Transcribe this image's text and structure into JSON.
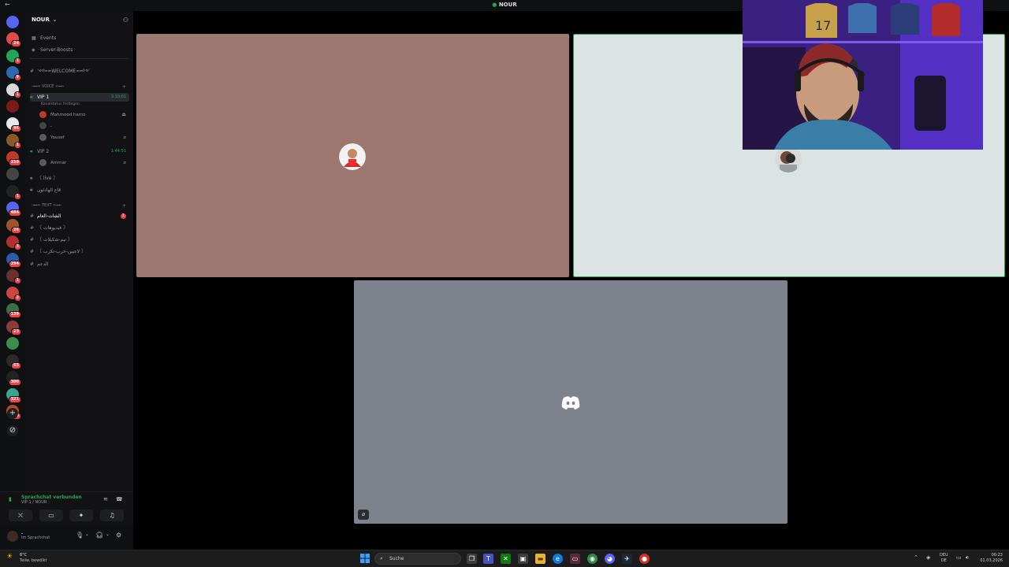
{
  "window": {
    "title": "NOUR",
    "back_glyph": "←"
  },
  "server_rail": {
    "servers": [
      {
        "name": "server-1",
        "color": "#e24a4a",
        "badge": "24"
      },
      {
        "name": "server-2",
        "color": "#23a559",
        "badge": "1"
      },
      {
        "name": "server-3",
        "color": "#2b6cb0",
        "badge": "9"
      },
      {
        "name": "server-4",
        "color": "#d9d9d9",
        "badge": "1"
      },
      {
        "name": "server-5",
        "color": "#7a1a1a",
        "badge": ""
      },
      {
        "name": "server-6",
        "color": "#e8e8e8",
        "badge": "96"
      },
      {
        "name": "server-7",
        "color": "#8b5a2b",
        "badge": "1"
      },
      {
        "name": "server-8",
        "color": "#c0392b",
        "badge": "210"
      },
      {
        "name": "server-9",
        "color": "#444",
        "badge": ""
      },
      {
        "name": "server-10",
        "color": "#222",
        "badge": "1"
      },
      {
        "name": "server-11",
        "color": "#5865f2",
        "badge": "484"
      },
      {
        "name": "server-12",
        "color": "#a0522d",
        "badge": "26"
      },
      {
        "name": "server-13",
        "color": "#b03030",
        "badge": "3"
      },
      {
        "name": "server-14",
        "color": "#2e5aa8",
        "badge": "294"
      },
      {
        "name": "server-15",
        "color": "#6b2f2f",
        "badge": "1"
      },
      {
        "name": "server-16",
        "color": "#c44",
        "badge": "2"
      },
      {
        "name": "server-17",
        "color": "#3c6e47",
        "badge": "139"
      },
      {
        "name": "server-18",
        "color": "#8a3a3a",
        "badge": "23"
      },
      {
        "name": "server-19",
        "color": "#3c8c4c",
        "badge": ""
      },
      {
        "name": "server-20",
        "color": "#2a2a2a",
        "badge": "55"
      },
      {
        "name": "server-21",
        "color": "#222",
        "badge": "300"
      },
      {
        "name": "server-22",
        "color": "#3ba58f",
        "badge": "321"
      },
      {
        "name": "server-23",
        "color": "#b84a1a",
        "badge": "308"
      }
    ],
    "add_glyph": "+",
    "explore_glyph": "⊘"
  },
  "sidebar": {
    "server_name": "NOUR",
    "links": [
      {
        "icon": "▦",
        "label": "Events"
      },
      {
        "icon": "◈",
        "label": "Server-Boosts"
      }
    ],
    "welcome_channel": "༺━≍WELCOME≍━༻",
    "voice_category": "⇝━≍ VOICE ≍━⇜",
    "vip1": {
      "label": "VIP 1",
      "time": "3:10:01",
      "status": "Kanalstatus festlegen"
    },
    "vip1_users": [
      {
        "name": "Mahmood hamo",
        "color": "#c0392b"
      },
      {
        "name": "ـ",
        "color": "#444"
      },
      {
        "name": "Yousef",
        "color": "#5a5a5a"
      }
    ],
    "vip2": {
      "label": "VIP 2",
      "time": "1:44:51"
    },
    "vip2_users": [
      {
        "name": "Ammar",
        "color": "#5a5a5a"
      }
    ],
    "voice_extra": [
      {
        "label": "〘 live 〙"
      },
      {
        "label": "قاع الهادئون"
      }
    ],
    "text_category": "⇝━≍ TEXT ≍━⇜",
    "text_channels": [
      {
        "label": "الشات-العام",
        "unread": "1"
      },
      {
        "label": "〘 فيديوهات 〙"
      },
      {
        "label": "〘 تيم-شكيلات 〙"
      },
      {
        "label": "〘 لاعبين-حرب-تكرب 〙"
      },
      {
        "label": "الدعم"
      }
    ]
  },
  "voice_panel": {
    "status": "Sprachchat verbunden",
    "channel": "VIP 1 / NOUR",
    "buttons": [
      {
        "name": "camera-off",
        "glyph": "⛌"
      },
      {
        "name": "screen-share",
        "glyph": "▭"
      },
      {
        "name": "activities",
        "glyph": "✦"
      },
      {
        "name": "soundboard",
        "glyph": "♫"
      }
    ]
  },
  "user_panel": {
    "name": "ـ",
    "status": "Im Sprachchat"
  },
  "stage": {
    "tile_a_user": "Mahmood hamo",
    "tile_c_muted_glyph": "⌀"
  },
  "taskbar": {
    "weather_temp": "6°C",
    "weather_desc": "Teilw. bewölkt",
    "search_placeholder": "Suche",
    "lang_top": "DEU",
    "lang_bottom": "DE",
    "time": "00:23",
    "date": "01.03.2026"
  },
  "colors": {
    "tile_a": "#9b7770",
    "tile_b": "#dce4e3",
    "tile_c": "#7d828d",
    "speaking": "#23a559",
    "badge": "#f23f43"
  }
}
